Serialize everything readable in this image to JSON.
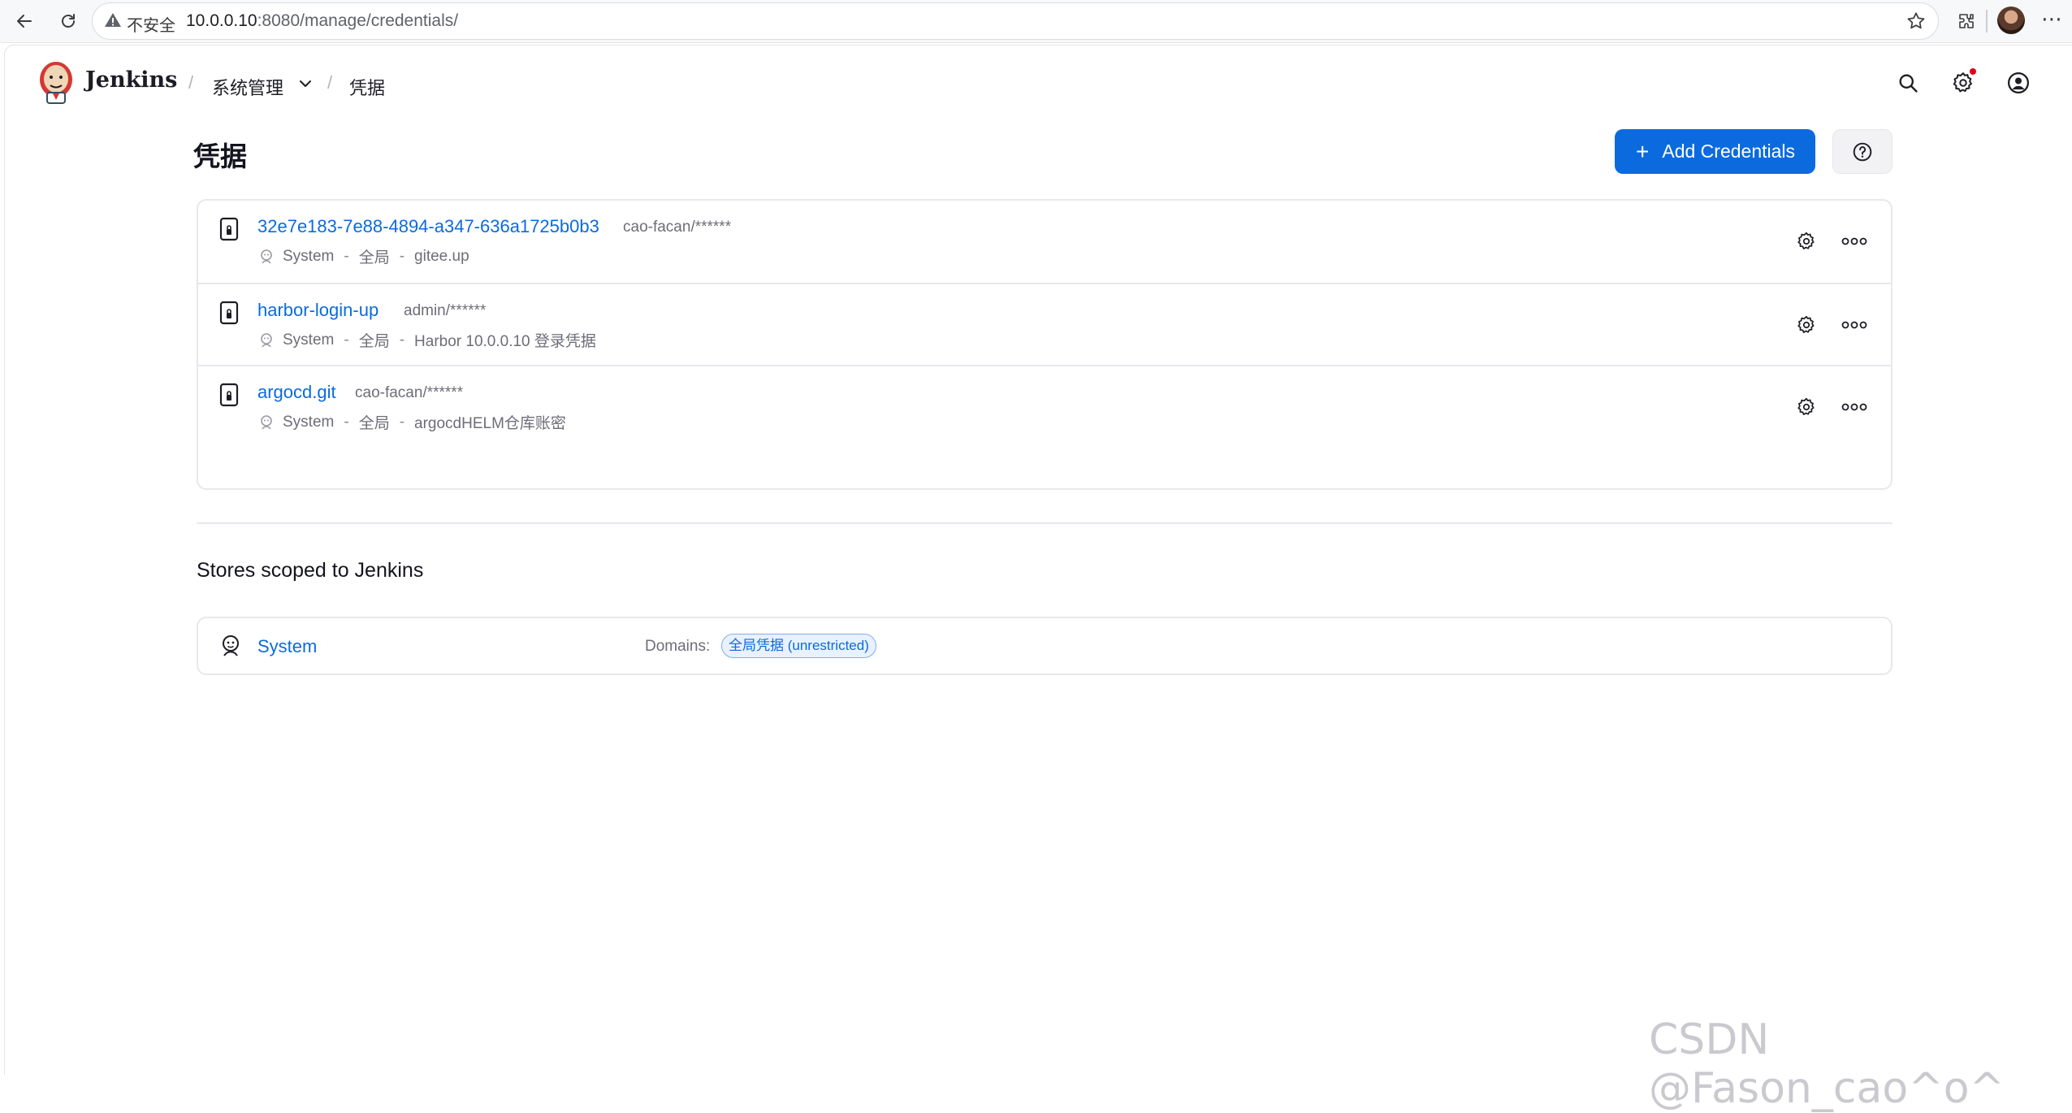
{
  "browser": {
    "insecure_label": "不安全",
    "url_host": "10.0.0.10",
    "url_rest": ":8080/manage/credentials/"
  },
  "header": {
    "brand": "Jenkins",
    "breadcrumbs": [
      "系统管理",
      "凭据"
    ]
  },
  "page": {
    "title": "凭据",
    "add_button_label": "Add Credentials",
    "accent": "#0b6bde"
  },
  "credentials": [
    {
      "id": "32e7e183-7e88-4894-a347-636a1725b0b3",
      "user": "cao-facan/******",
      "store": "System",
      "domain": "全局",
      "description": "gitee.up"
    },
    {
      "id": "harbor-login-up",
      "user": "admin/******",
      "store": "System",
      "domain": "全局",
      "description": "Harbor 10.0.0.10 登录凭据"
    },
    {
      "id": "argocd.git",
      "user": "cao-facan/******",
      "store": "System",
      "domain": "全局",
      "description": "argocdHELM仓库账密"
    }
  ],
  "stores": {
    "heading": "Stores scoped to Jenkins",
    "items": [
      {
        "name": "System",
        "domains_label": "Domains:",
        "domain": "全局凭据 (unrestricted)"
      }
    ]
  },
  "watermark": "CSDN @Fason_cao^o^"
}
